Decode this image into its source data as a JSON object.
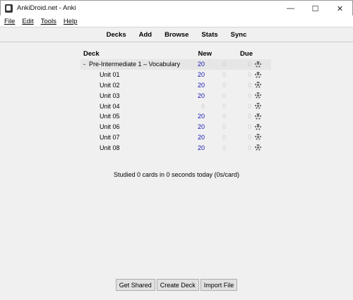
{
  "window": {
    "title": "AnkiDroid.net - Anki"
  },
  "controls": {
    "minimize": "—",
    "maximize": "☐",
    "close": "✕"
  },
  "menu": [
    {
      "label": "File"
    },
    {
      "label": "Edit"
    },
    {
      "label": "Tools"
    },
    {
      "label": "Help"
    }
  ],
  "toolbar": [
    "Decks",
    "Add",
    "Browse",
    "Stats",
    "Sync"
  ],
  "table": {
    "headers": {
      "deck": "Deck",
      "new": "New",
      "due": "Due"
    },
    "rows": [
      {
        "collapse": "-",
        "name": "Pre-Intermediate 1 – Vocabulary",
        "new": "20",
        "learn": "0",
        "due": "0",
        "current": true
      },
      {
        "name": "Unit 01",
        "new": "20",
        "learn": "0",
        "due": "0"
      },
      {
        "name": "Unit 02",
        "new": "20",
        "learn": "0",
        "due": "0"
      },
      {
        "name": "Unit 03",
        "new": "20",
        "learn": "0",
        "due": "0"
      },
      {
        "name": "Unit 04",
        "new": "0",
        "learn": "0",
        "due": "0"
      },
      {
        "name": "Unit 05",
        "new": "20",
        "learn": "0",
        "due": "0"
      },
      {
        "name": "Unit 06",
        "new": "20",
        "learn": "0",
        "due": "0"
      },
      {
        "name": "Unit 07",
        "new": "20",
        "learn": "0",
        "due": "0"
      },
      {
        "name": "Unit 08",
        "new": "20",
        "learn": "0",
        "due": "0"
      }
    ]
  },
  "studied": "Studied 0 cards in 0 seconds today (0s/card)",
  "buttons": [
    "Get Shared",
    "Create Deck",
    "Import File"
  ],
  "icons": {
    "app": "anki-app-icon",
    "gear": "gear-icon"
  }
}
